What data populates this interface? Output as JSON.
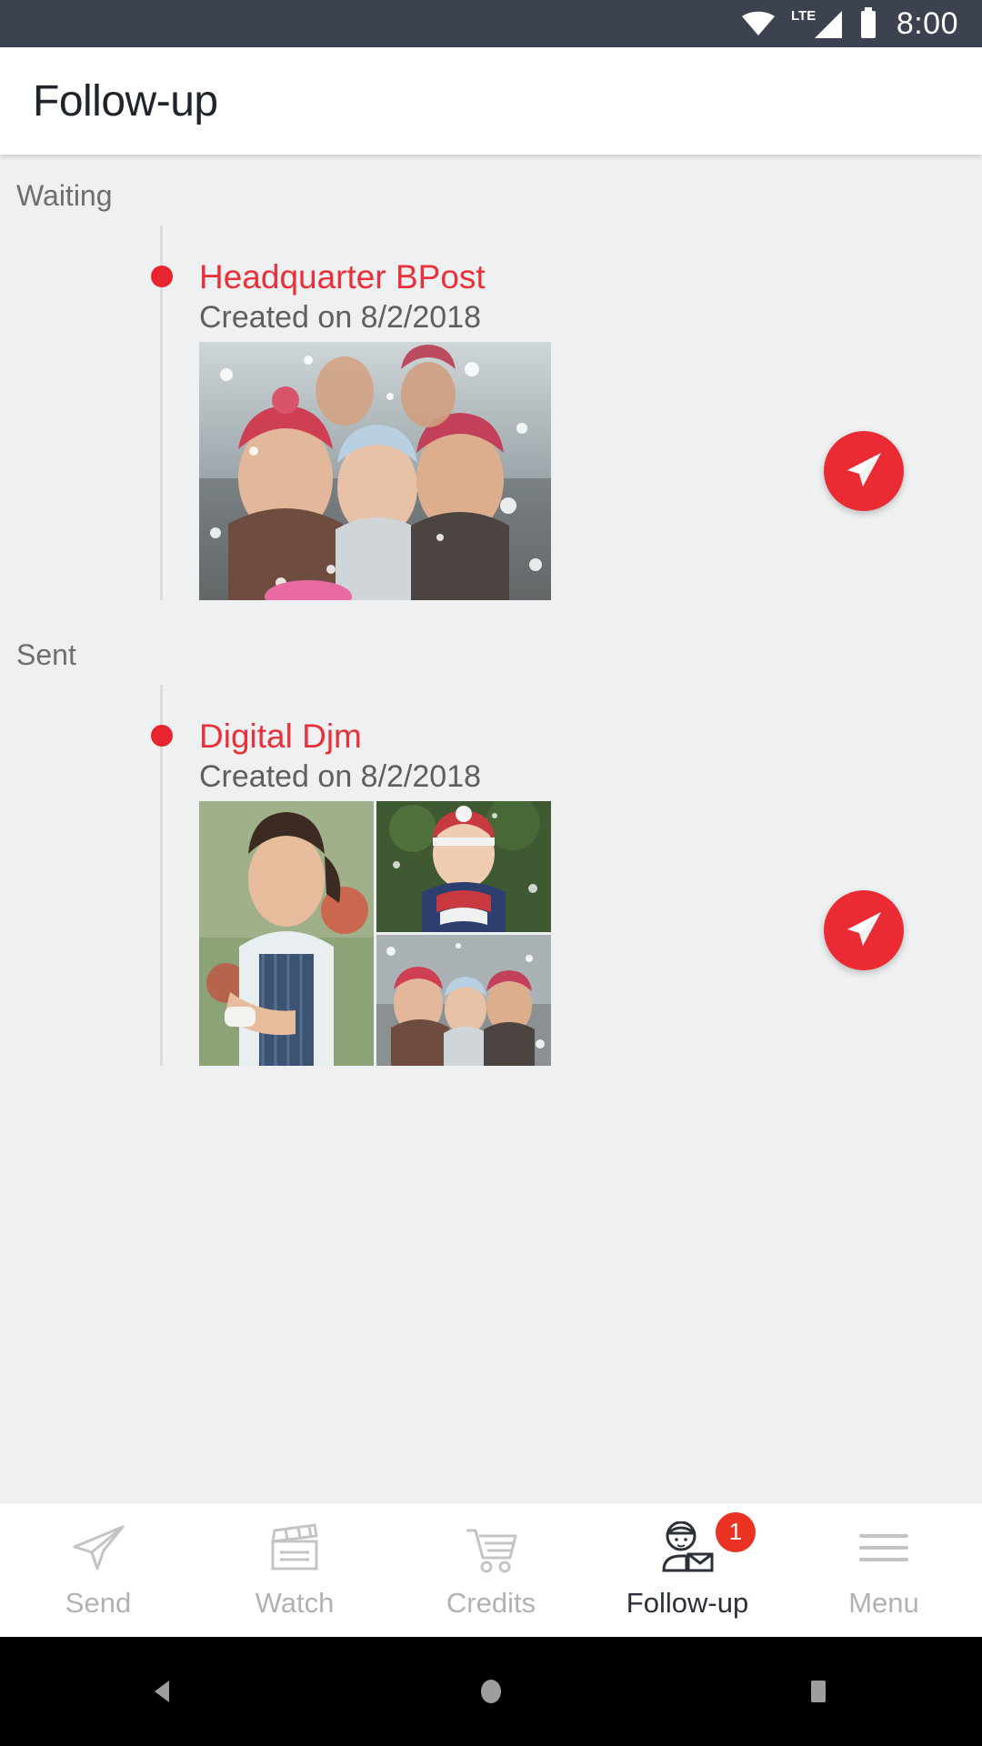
{
  "status_bar": {
    "time": "8:00",
    "network_label": "LTE",
    "icons": [
      "wifi-icon",
      "cellular-signal-icon",
      "battery-icon"
    ],
    "background_color": "#3c4250"
  },
  "app_bar": {
    "title": "Follow-up"
  },
  "theme": {
    "accent_red": "#e8313b",
    "fab_red": "#ea2b34",
    "badge_red": "#ea3323",
    "content_background": "#eff0f1",
    "muted_text": "#6e6e6e"
  },
  "sections": [
    {
      "label": "Waiting",
      "entries": [
        {
          "title": "Headquarter BPost",
          "date": "Created on 8/2/2018",
          "action_label": "send-icon",
          "media_layout": "single"
        }
      ]
    },
    {
      "label": "Sent",
      "entries": [
        {
          "title": "Digital Djm",
          "date": "Created on 8/2/2018",
          "action_label": "send-icon",
          "media_layout": "collage"
        }
      ]
    }
  ],
  "bottom_nav": {
    "items": [
      {
        "label": "Send",
        "icon": "paper-plane-icon",
        "active": false,
        "badge": ""
      },
      {
        "label": "Watch",
        "icon": "clapperboard-icon",
        "active": false,
        "badge": ""
      },
      {
        "label": "Credits",
        "icon": "shopping-cart-icon",
        "active": false,
        "badge": ""
      },
      {
        "label": "Follow-up",
        "icon": "postman-mail-icon",
        "active": true,
        "badge": "1"
      },
      {
        "label": "Menu",
        "icon": "hamburger-menu-icon",
        "active": false,
        "badge": ""
      }
    ]
  },
  "android_nav": {
    "buttons": [
      "back-button",
      "home-button",
      "recents-button"
    ]
  }
}
